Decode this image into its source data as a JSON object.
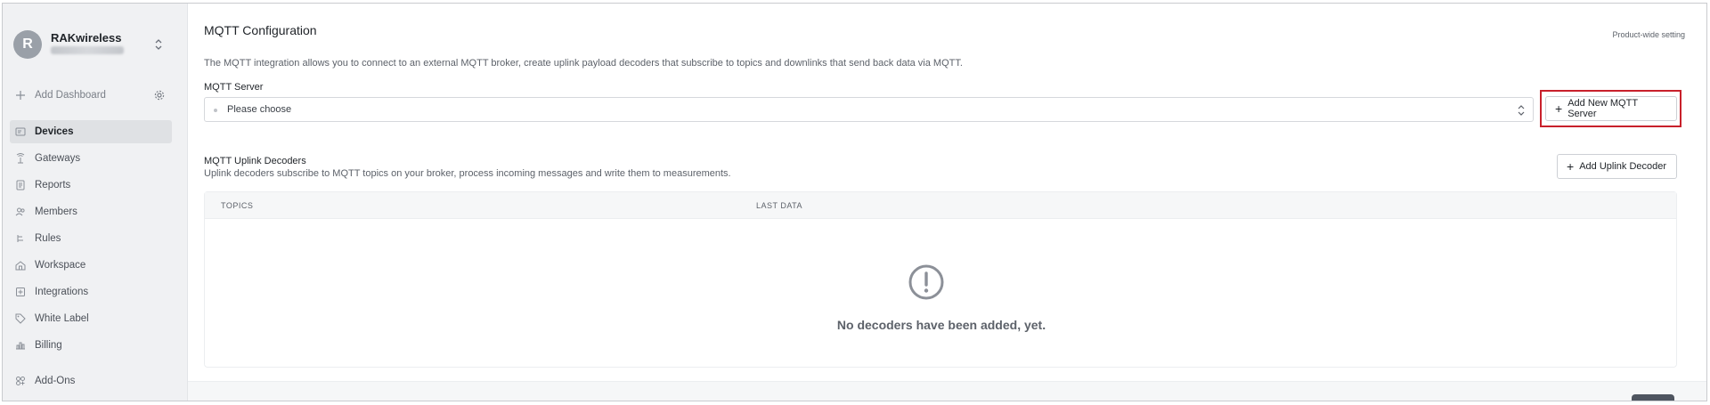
{
  "sidebar": {
    "org": {
      "avatar_letter": "R",
      "name": "RAKwireless"
    },
    "add_dashboard": "Add Dashboard",
    "items": [
      {
        "label": "Devices",
        "icon": "devices-icon",
        "active": true
      },
      {
        "label": "Gateways",
        "icon": "gateway-icon",
        "active": false
      },
      {
        "label": "Reports",
        "icon": "report-icon",
        "active": false
      },
      {
        "label": "Members",
        "icon": "members-icon",
        "active": false
      },
      {
        "label": "Rules",
        "icon": "rules-icon",
        "active": false
      },
      {
        "label": "Workspace",
        "icon": "workspace-icon",
        "active": false
      },
      {
        "label": "Integrations",
        "icon": "integrations-icon",
        "active": false
      },
      {
        "label": "White Label",
        "icon": "tag-icon",
        "active": false
      },
      {
        "label": "Billing",
        "icon": "billing-icon",
        "active": false
      },
      {
        "label": "Add-Ons",
        "icon": "addons-icon",
        "active": false
      }
    ]
  },
  "main": {
    "title": "MQTT Configuration",
    "scope": "Product-wide setting",
    "description": "The MQTT integration allows you to connect to an external MQTT broker, create uplink payload decoders that subscribe to topics and downlinks that send back data via MQTT.",
    "server_label": "MQTT Server",
    "server_select_value": "Please choose",
    "add_server_button": "Add New MQTT Server",
    "decoders_title": "MQTT Uplink Decoders",
    "decoders_description": "Uplink decoders subscribe to MQTT topics on your broker, process incoming messages and write them to measurements.",
    "add_decoder_button": "Add Uplink Decoder",
    "table": {
      "columns": [
        "TOPICS",
        "LAST DATA"
      ],
      "empty_message": "No decoders have been added, yet."
    }
  },
  "colors": {
    "highlight": "#c8202b",
    "active_nav": "#dfe1e4",
    "sidebar_bg": "#f0f1f3"
  }
}
